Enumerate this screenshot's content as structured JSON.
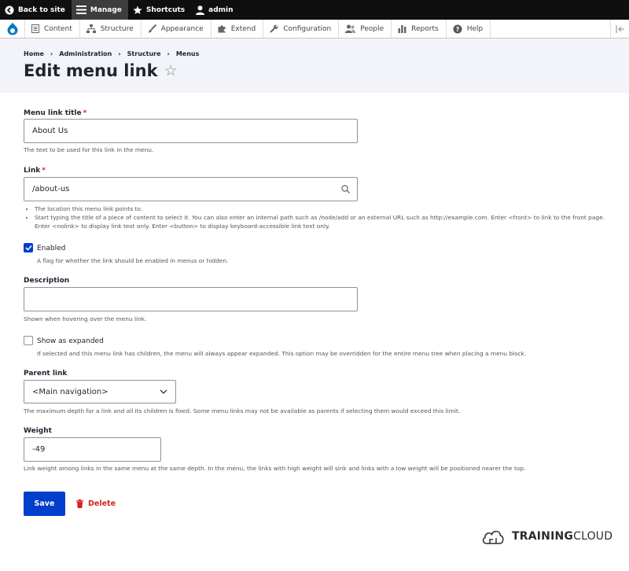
{
  "toolbar": {
    "back_to_site": "Back to site",
    "manage": "Manage",
    "shortcuts": "Shortcuts",
    "user": "admin"
  },
  "tray": {
    "items": [
      "Content",
      "Structure",
      "Appearance",
      "Extend",
      "Configuration",
      "People",
      "Reports",
      "Help"
    ]
  },
  "breadcrumb": [
    "Home",
    "Administration",
    "Structure",
    "Menus"
  ],
  "page": {
    "title": "Edit menu link"
  },
  "form": {
    "title_field": {
      "label": "Menu link title",
      "required_mark": "*",
      "value": "About Us",
      "help": "The text to be used for this link in the menu."
    },
    "link_field": {
      "label": "Link",
      "required_mark": "*",
      "value": "/about-us",
      "help": [
        "The location this menu link points to.",
        "Start typing the title of a piece of content to select it. You can also enter an internal path such as /node/add or an external URL such as http://example.com. Enter <front> to link to the front page. Enter <nolink> to display link text only. Enter <button> to display keyboard-accessible link text only."
      ]
    },
    "enabled": {
      "label": "Enabled",
      "checked": true,
      "help": "A flag for whether the link should be enabled in menus or hidden."
    },
    "description": {
      "label": "Description",
      "value": "",
      "help": "Shown when hovering over the menu link."
    },
    "expanded": {
      "label": "Show as expanded",
      "checked": false,
      "help": "If selected and this menu link has children, the menu will always appear expanded. This option may be overridden for the entire menu tree when placing a menu block."
    },
    "parent": {
      "label": "Parent link",
      "selected": "<Main navigation>",
      "help": "The maximum depth for a link and all its children is fixed. Some menu links may not be available as parents if selecting them would exceed this limit."
    },
    "weight": {
      "label": "Weight",
      "value": "-49",
      "help": "Link weight among links in the same menu at the same depth. In the menu, the links with high weight will sink and links with a low weight will be positioned nearer the top."
    }
  },
  "actions": {
    "save": "Save",
    "delete": "Delete"
  },
  "brand": {
    "part1": "TRAINING",
    "part2": "CLOUD"
  },
  "colors": {
    "primary": "#003ecc",
    "danger": "#d72222",
    "toolbar": "#0f0f0f"
  }
}
